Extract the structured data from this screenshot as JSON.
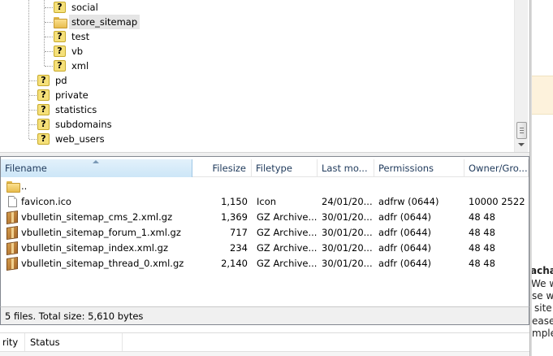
{
  "tree": {
    "items": [
      {
        "label": "social",
        "icon": "question-icon",
        "level": 2
      },
      {
        "label": "store_sitemap",
        "icon": "folder-icon",
        "level": 2,
        "selected": true
      },
      {
        "label": "test",
        "icon": "question-icon",
        "level": 2
      },
      {
        "label": "vb",
        "icon": "question-icon",
        "level": 2
      },
      {
        "label": "xml",
        "icon": "question-icon",
        "level": 2
      },
      {
        "label": "pd",
        "icon": "question-icon",
        "level": 1
      },
      {
        "label": "private",
        "icon": "question-icon",
        "level": 1
      },
      {
        "label": "statistics",
        "icon": "question-icon",
        "level": 1
      },
      {
        "label": "subdomains",
        "icon": "question-icon",
        "level": 1
      },
      {
        "label": "web_users",
        "icon": "question-icon",
        "level": 1
      }
    ],
    "unknown_icon_glyph": "?"
  },
  "file_list": {
    "columns": [
      "Filename",
      "Filesize",
      "Filetype",
      "Last mo...",
      "Permissions",
      "Owner/Gro..."
    ],
    "sorted_column": "Filename",
    "parent_entry": "..",
    "rows": [
      {
        "name": "favicon.ico",
        "size": "1,150",
        "type": "Icon",
        "modified": "24/01/20...",
        "permissions": "adfrw (0644)",
        "owner": "10000 2522",
        "icon": "file-icon"
      },
      {
        "name": "vbulletin_sitemap_cms_2.xml.gz",
        "size": "1,369",
        "type": "GZ Archive...",
        "modified": "30/01/20...",
        "permissions": "adfr (0644)",
        "owner": "48 48",
        "icon": "archive-icon"
      },
      {
        "name": "vbulletin_sitemap_forum_1.xml.gz",
        "size": "717",
        "type": "GZ Archive...",
        "modified": "30/01/20...",
        "permissions": "adfr (0644)",
        "owner": "48 48",
        "icon": "archive-icon"
      },
      {
        "name": "vbulletin_sitemap_index.xml.gz",
        "size": "234",
        "type": "GZ Archive...",
        "modified": "30/01/20...",
        "permissions": "adfr (0644)",
        "owner": "48 48",
        "icon": "archive-icon"
      },
      {
        "name": "vbulletin_sitemap_thread_0.xml.gz",
        "size": "2,140",
        "type": "GZ Archive...",
        "modified": "30/01/20...",
        "permissions": "adfr (0644)",
        "owner": "48 48",
        "icon": "archive-icon"
      }
    ],
    "status": "5 files. Total size: 5,610 bytes"
  },
  "queue": {
    "columns": [
      "rity",
      "Status"
    ]
  },
  "right_pane": {
    "lines": [
      "acha",
      "We w",
      "se w",
      "site",
      "ease",
      "mple"
    ]
  },
  "colors": {
    "selection": "#e5e5e5",
    "sorted_header": "#cde6f7",
    "status_bar": "#f0f0f0",
    "right_band": "#fdf2dc"
  }
}
